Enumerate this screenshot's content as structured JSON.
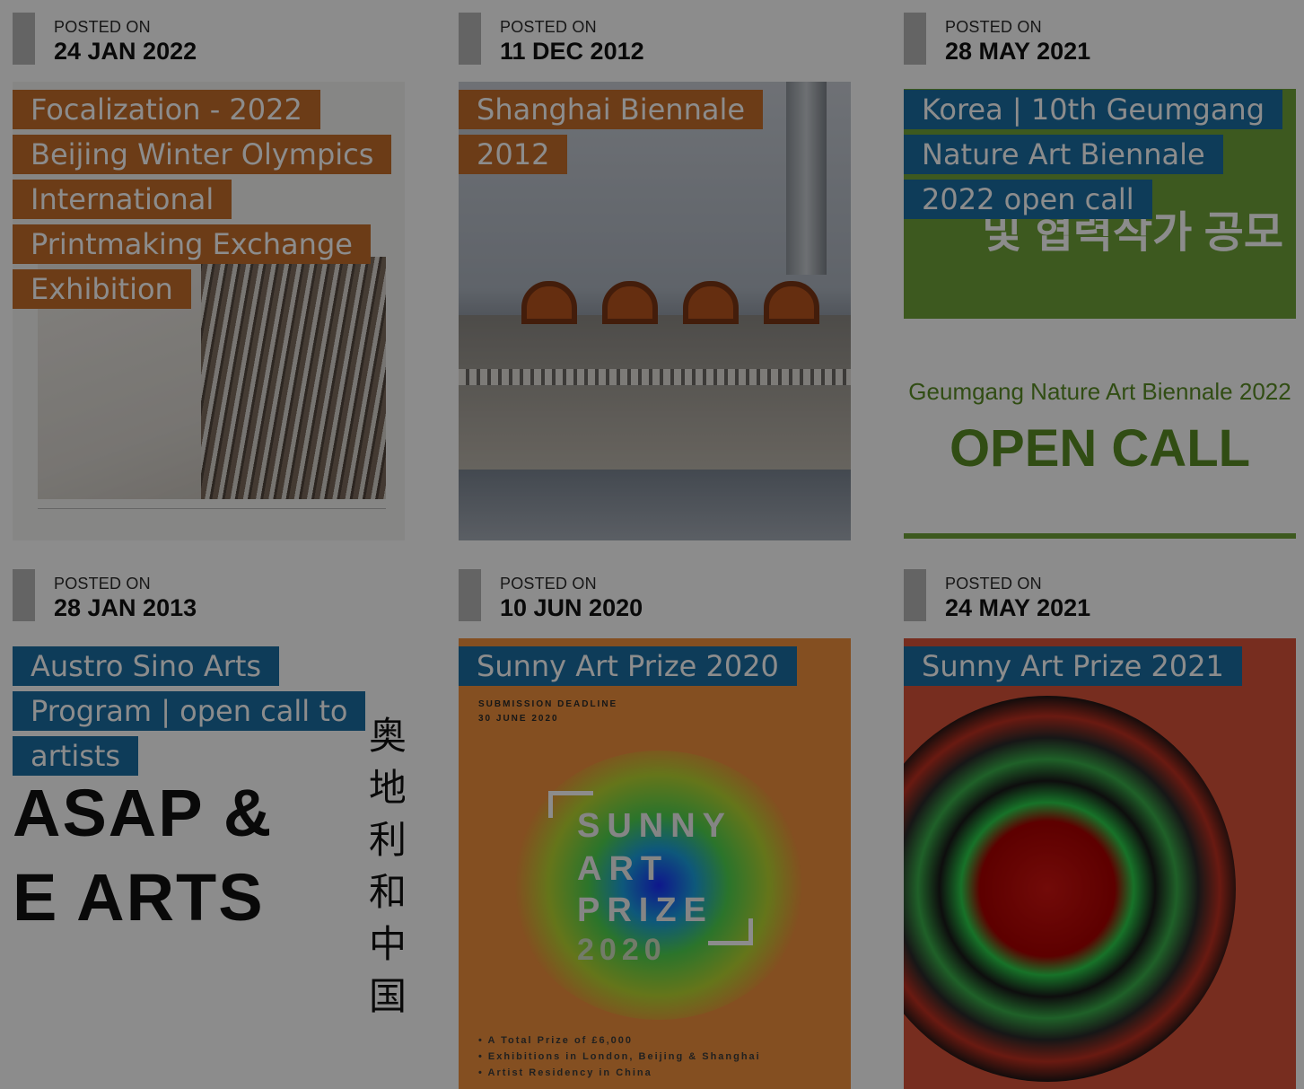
{
  "posts": [
    {
      "posted_label": "POSTED ON",
      "date": "24 JAN 2022",
      "title": "Focalization - 2022 Beijing Winter Olympics International Printmaking Exchange Exhibition",
      "tag_color": "#c56e2a"
    },
    {
      "posted_label": "POSTED ON",
      "date": "11 DEC 2012",
      "title": "Shanghai Biennale 2012",
      "tag_color": "#c56e2a"
    },
    {
      "posted_label": "POSTED ON",
      "date": "28 MAY 2021",
      "title": "Korea | 10th Geumgang Nature Art Biennale 2022 open call",
      "tag_color": "#1a6ea3"
    },
    {
      "posted_label": "POSTED ON",
      "date": "28 JAN 2013",
      "title": "Austro Sino Arts Program | open call to artists",
      "tag_color": "#1a6ea3"
    },
    {
      "posted_label": "POSTED ON",
      "date": "10 JUN 2020",
      "title": "Sunny Art Prize 2020",
      "tag_color": "#1a6ea3"
    },
    {
      "posted_label": "POSTED ON",
      "date": "24 MAY 2021",
      "title": "Sunny Art Prize 2021",
      "tag_color": "#1a6ea3"
    }
  ],
  "images": {
    "geumgang": {
      "korean": "및 협력작가 공모",
      "subtitle": "Geumgang Nature Art Biennale 2022",
      "headline": "OPEN CALL"
    },
    "asap": {
      "line1": "ASAP &",
      "line2": "E ARTS",
      "chinese": "奥地利和中国"
    },
    "sunny2020": {
      "deadline": "SUBMISSION DEADLINE",
      "deadline_date": "30 JUNE 2020",
      "w1": "SUNNY",
      "w2": "ART",
      "w3": "PRIZE",
      "year": "2020",
      "b1": "• A Total Prize of £6,000",
      "b2": "• Exhibitions in London, Beijing & Shanghai",
      "b3": "• Artist Residency in China"
    }
  },
  "colors": {
    "orange": "#c56e2a",
    "blue": "#1a6ea3",
    "overlay": "rgba(0,0,0,0.45)"
  }
}
